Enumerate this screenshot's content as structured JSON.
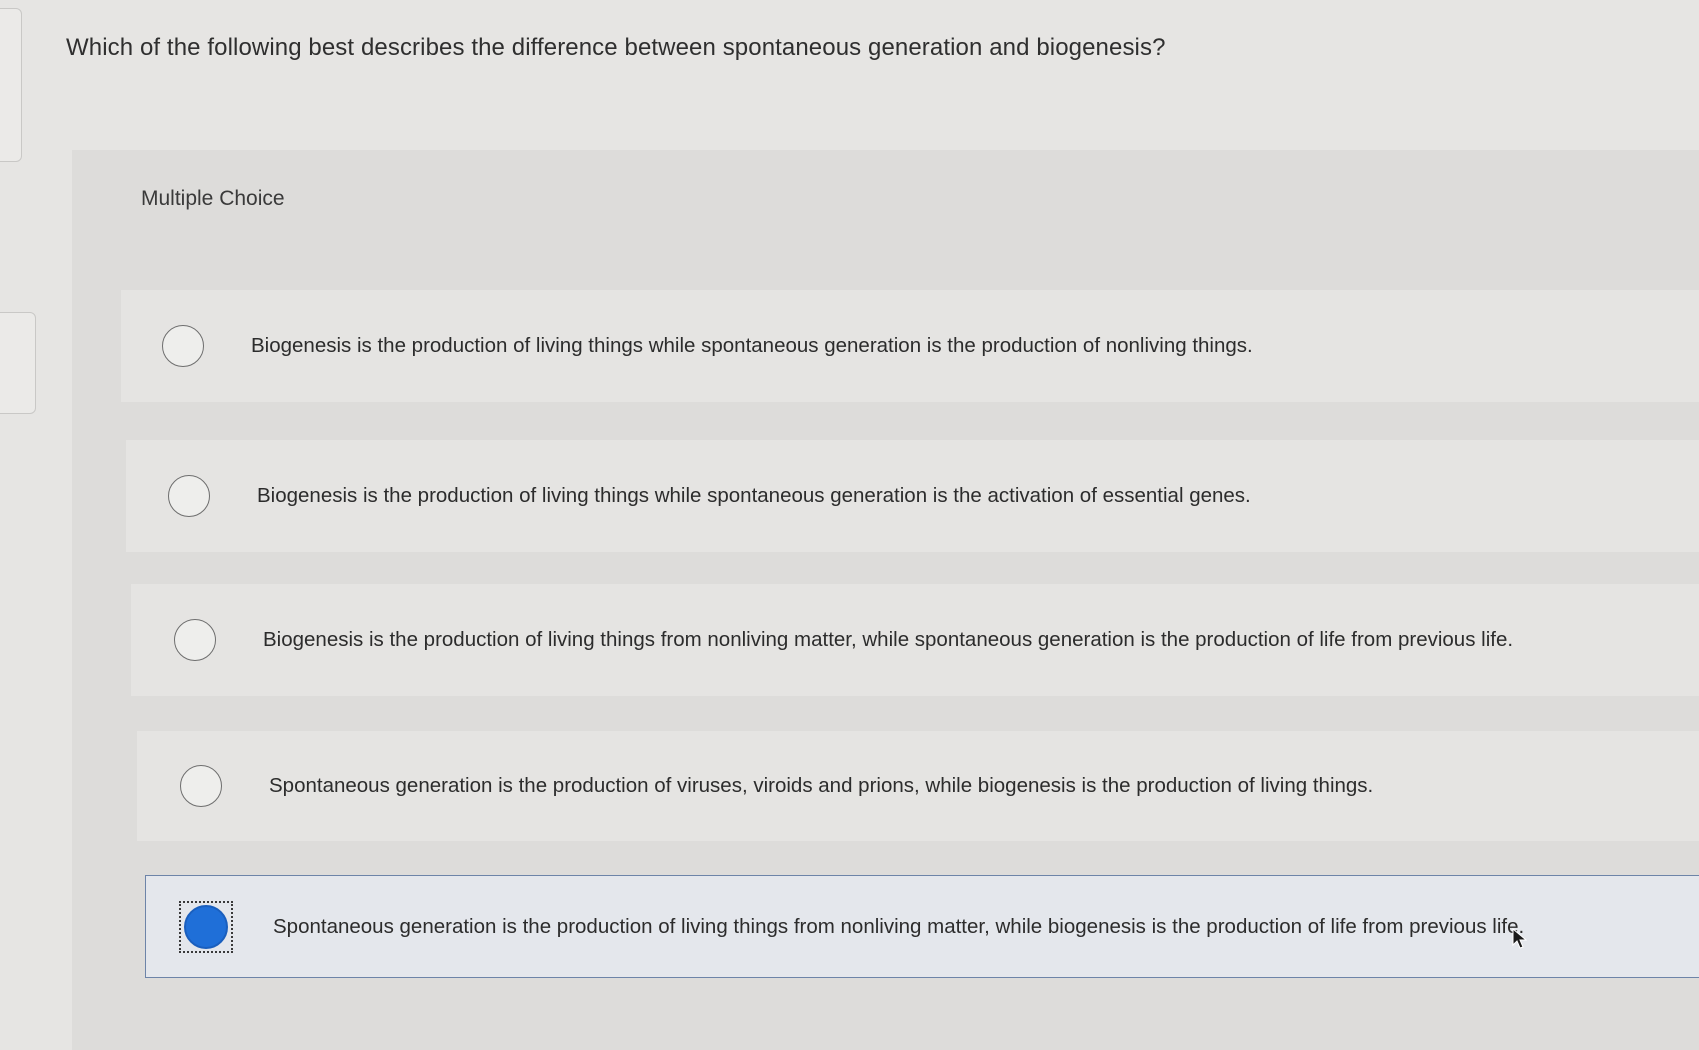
{
  "question": {
    "text": "Which of the following best describes the difference between spontaneous generation and biogenesis?"
  },
  "question_type": "Multiple Choice",
  "options": [
    {
      "label": "Biogenesis is the production of living things while spontaneous generation is the production of nonliving things.",
      "selected": false
    },
    {
      "label": "Biogenesis is the production of living things while spontaneous generation is the activation of essential genes.",
      "selected": false
    },
    {
      "label": "Biogenesis is the production of living things from nonliving matter, while spontaneous generation is the production of life from previous life.",
      "selected": false
    },
    {
      "label": "Spontaneous generation is the production of viruses, viroids and prions, while biogenesis is the production of living things.",
      "selected": false
    },
    {
      "label": "Spontaneous generation is the production of living things from nonliving matter, while biogenesis is the production of life from previous life.",
      "selected": true
    }
  ],
  "colors": {
    "page_bg": "#e6e5e3",
    "option_bg": "#e5e4e2",
    "selected_fill": "#1f6fd8",
    "selected_border": "#6d84a8",
    "radio_border": "#6e6e6e"
  },
  "icons": {
    "cursor": "mouse-pointer-icon",
    "radio_empty": "radio-unchecked-icon",
    "radio_filled": "radio-checked-icon"
  }
}
